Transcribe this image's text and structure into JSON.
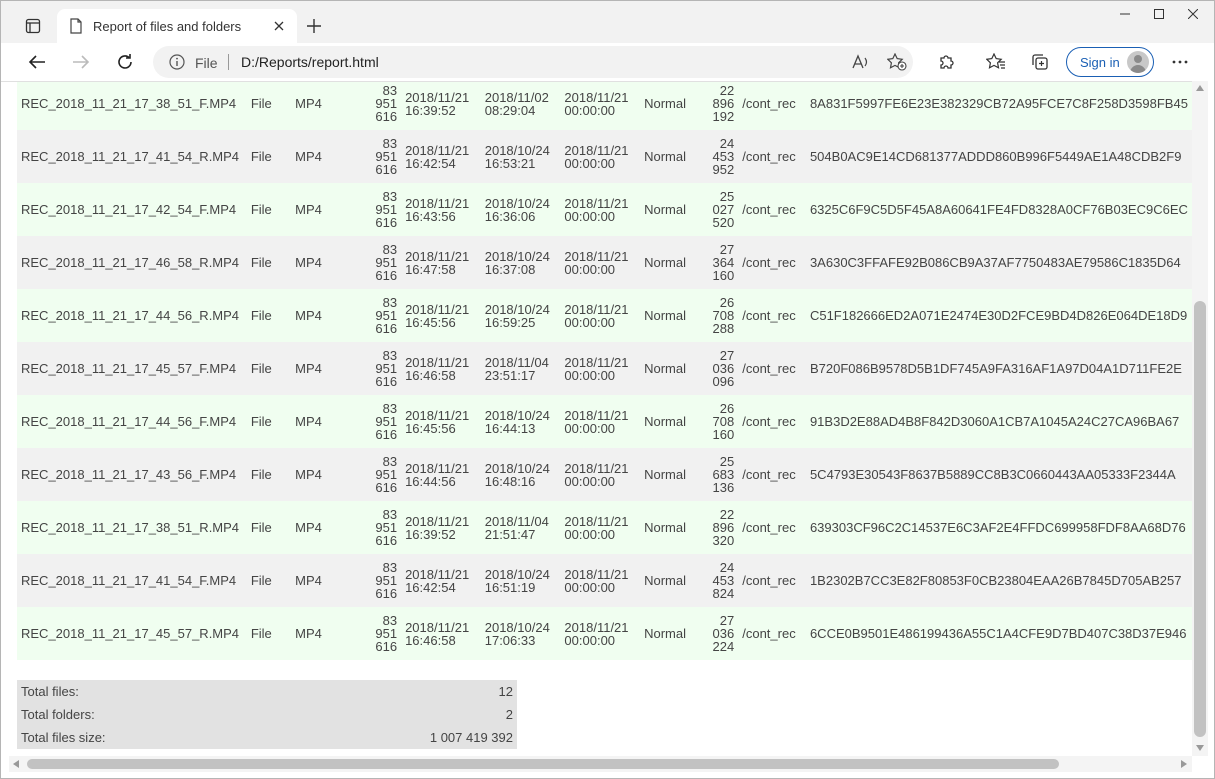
{
  "tab": {
    "title": "Report of files and folders"
  },
  "address": {
    "scheme": "File",
    "url": "D:/Reports/report.html"
  },
  "toolbar": {
    "signin_label": "Sign in"
  },
  "rows": [
    {
      "name": "REC_2018_11_21_17_38_51_F.MP4",
      "type": "File",
      "ext": "MP4",
      "size": [
        "83",
        "951",
        "616"
      ],
      "created": [
        "2018/11/21",
        "16:39:52"
      ],
      "modified": [
        "2018/11/02",
        "08:29:04"
      ],
      "accessed": [
        "2018/11/21",
        "00:00:00"
      ],
      "attr": "Normal",
      "bytes": [
        "22",
        "896",
        "192"
      ],
      "path": "/cont_rec",
      "hash": "8A831F5997FE6E23E382329CB72A95FCE7C8F258D3598FB45"
    },
    {
      "name": "REC_2018_11_21_17_41_54_R.MP4",
      "type": "File",
      "ext": "MP4",
      "size": [
        "83",
        "951",
        "616"
      ],
      "created": [
        "2018/11/21",
        "16:42:54"
      ],
      "modified": [
        "2018/10/24",
        "16:53:21"
      ],
      "accessed": [
        "2018/11/21",
        "00:00:00"
      ],
      "attr": "Normal",
      "bytes": [
        "24",
        "453",
        "952"
      ],
      "path": "/cont_rec",
      "hash": "504B0AC9E14CD681377ADDD860B996F5449AE1A48CDB2F9"
    },
    {
      "name": "REC_2018_11_21_17_42_54_F.MP4",
      "type": "File",
      "ext": "MP4",
      "size": [
        "83",
        "951",
        "616"
      ],
      "created": [
        "2018/11/21",
        "16:43:56"
      ],
      "modified": [
        "2018/10/24",
        "16:36:06"
      ],
      "accessed": [
        "2018/11/21",
        "00:00:00"
      ],
      "attr": "Normal",
      "bytes": [
        "25",
        "027",
        "520"
      ],
      "path": "/cont_rec",
      "hash": "6325C6F9C5D5F45A8A60641FE4FD8328A0CF76B03EC9C6EC"
    },
    {
      "name": "REC_2018_11_21_17_46_58_R.MP4",
      "type": "File",
      "ext": "MP4",
      "size": [
        "83",
        "951",
        "616"
      ],
      "created": [
        "2018/11/21",
        "16:47:58"
      ],
      "modified": [
        "2018/10/24",
        "16:37:08"
      ],
      "accessed": [
        "2018/11/21",
        "00:00:00"
      ],
      "attr": "Normal",
      "bytes": [
        "27",
        "364",
        "160"
      ],
      "path": "/cont_rec",
      "hash": "3A630C3FFAFE92B086CB9A37AF7750483AE79586C1835D64"
    },
    {
      "name": "REC_2018_11_21_17_44_56_R.MP4",
      "type": "File",
      "ext": "MP4",
      "size": [
        "83",
        "951",
        "616"
      ],
      "created": [
        "2018/11/21",
        "16:45:56"
      ],
      "modified": [
        "2018/10/24",
        "16:59:25"
      ],
      "accessed": [
        "2018/11/21",
        "00:00:00"
      ],
      "attr": "Normal",
      "bytes": [
        "26",
        "708",
        "288"
      ],
      "path": "/cont_rec",
      "hash": "C51F182666ED2A071E2474E30D2FCE9BD4D826E064DE18D9"
    },
    {
      "name": "REC_2018_11_21_17_45_57_F.MP4",
      "type": "File",
      "ext": "MP4",
      "size": [
        "83",
        "951",
        "616"
      ],
      "created": [
        "2018/11/21",
        "16:46:58"
      ],
      "modified": [
        "2018/11/04",
        "23:51:17"
      ],
      "accessed": [
        "2018/11/21",
        "00:00:00"
      ],
      "attr": "Normal",
      "bytes": [
        "27",
        "036",
        "096"
      ],
      "path": "/cont_rec",
      "hash": "B720F086B9578D5B1DF745A9FA316AF1A97D04A1D711FE2E"
    },
    {
      "name": "REC_2018_11_21_17_44_56_F.MP4",
      "type": "File",
      "ext": "MP4",
      "size": [
        "83",
        "951",
        "616"
      ],
      "created": [
        "2018/11/21",
        "16:45:56"
      ],
      "modified": [
        "2018/10/24",
        "16:44:13"
      ],
      "accessed": [
        "2018/11/21",
        "00:00:00"
      ],
      "attr": "Normal",
      "bytes": [
        "26",
        "708",
        "160"
      ],
      "path": "/cont_rec",
      "hash": "91B3D2E88AD4B8F842D3060A1CB7A1045A24C27CA96BA67"
    },
    {
      "name": "REC_2018_11_21_17_43_56_F.MP4",
      "type": "File",
      "ext": "MP4",
      "size": [
        "83",
        "951",
        "616"
      ],
      "created": [
        "2018/11/21",
        "16:44:56"
      ],
      "modified": [
        "2018/10/24",
        "16:48:16"
      ],
      "accessed": [
        "2018/11/21",
        "00:00:00"
      ],
      "attr": "Normal",
      "bytes": [
        "25",
        "683",
        "136"
      ],
      "path": "/cont_rec",
      "hash": "5C4793E30543F8637B5889CC8B3C0660443AA05333F2344A"
    },
    {
      "name": "REC_2018_11_21_17_38_51_R.MP4",
      "type": "File",
      "ext": "MP4",
      "size": [
        "83",
        "951",
        "616"
      ],
      "created": [
        "2018/11/21",
        "16:39:52"
      ],
      "modified": [
        "2018/11/04",
        "21:51:47"
      ],
      "accessed": [
        "2018/11/21",
        "00:00:00"
      ],
      "attr": "Normal",
      "bytes": [
        "22",
        "896",
        "320"
      ],
      "path": "/cont_rec",
      "hash": "639303CF96C2C14537E6C3AF2E4FFDC699958FDF8AA68D76"
    },
    {
      "name": "REC_2018_11_21_17_41_54_F.MP4",
      "type": "File",
      "ext": "MP4",
      "size": [
        "83",
        "951",
        "616"
      ],
      "created": [
        "2018/11/21",
        "16:42:54"
      ],
      "modified": [
        "2018/10/24",
        "16:51:19"
      ],
      "accessed": [
        "2018/11/21",
        "00:00:00"
      ],
      "attr": "Normal",
      "bytes": [
        "24",
        "453",
        "824"
      ],
      "path": "/cont_rec",
      "hash": "1B2302B7CC3E82F80853F0CB23804EAA26B7845D705AB257"
    },
    {
      "name": "REC_2018_11_21_17_45_57_R.MP4",
      "type": "File",
      "ext": "MP4",
      "size": [
        "83",
        "951",
        "616"
      ],
      "created": [
        "2018/11/21",
        "16:46:58"
      ],
      "modified": [
        "2018/10/24",
        "17:06:33"
      ],
      "accessed": [
        "2018/11/21",
        "00:00:00"
      ],
      "attr": "Normal",
      "bytes": [
        "27",
        "036",
        "224"
      ],
      "path": "/cont_rec",
      "hash": "6CCE0B9501E486199436A55C1A4CFE9D7BD407C38D37E946"
    }
  ],
  "totals": {
    "files_label": "Total files:",
    "files_value": "12",
    "folders_label": "Total folders:",
    "folders_value": "2",
    "size_label": "Total files size:",
    "size_value": "1 007 419 392"
  },
  "icons": {
    "tab_actions": "tab-actions-icon",
    "page": "page-icon",
    "close": "close-icon",
    "new_tab": "plus-icon",
    "back": "back-arrow-icon",
    "forward": "forward-arrow-icon",
    "refresh": "refresh-icon",
    "info": "info-icon",
    "read_aloud": "read-aloud-icon",
    "add_favorite": "add-favorite-icon",
    "extensions": "puzzle-icon",
    "favorites": "favorites-icon",
    "collections": "collections-icon",
    "more": "more-icon"
  }
}
